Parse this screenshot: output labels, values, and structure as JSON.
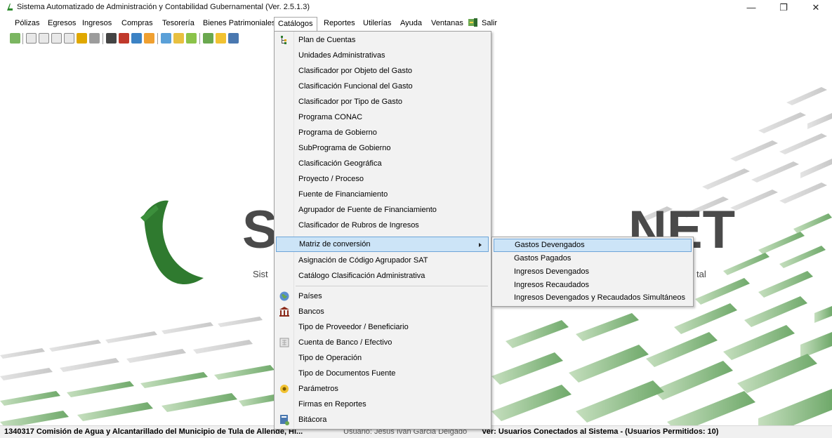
{
  "window": {
    "title": "Sistema Automatizado de Administración y Contabilidad Gubernamental  (Ver. 2.5.1.3)",
    "minimize": "—",
    "maximize": "❐",
    "close": "✕"
  },
  "menubar": {
    "items": [
      "Pólizas",
      "Egresos",
      "Ingresos",
      "Compras",
      "Tesorería",
      "Bienes Patrimoniales",
      "Catálogos",
      "Reportes",
      "Utilerías",
      "Ayuda",
      "Ventanas",
      "Salir"
    ]
  },
  "catalogos_menu": {
    "items": [
      "Plan de Cuentas",
      "Unidades Administrativas",
      "Clasificador por Objeto del Gasto",
      "Clasificación Funcional del Gasto",
      "Clasificador por Tipo de Gasto",
      "Programa CONAC",
      "Programa de Gobierno",
      "SubPrograma de Gobierno",
      "Clasificación Geográfica",
      "Proyecto / Proceso",
      "Fuente de Financiamiento",
      "Agrupador de Fuente de Financiamiento",
      "Clasificador de Rubros de Ingresos",
      "Matriz de conversión",
      "Asignación de Código Agrupador SAT",
      "Catálogo Clasificación Administrativa",
      "Países",
      "Bancos",
      "Tipo de Proveedor / Beneficiario",
      "Cuenta de Banco / Efectivo",
      "Tipo de Operación",
      "Tipo de Documentos Fuente",
      "Parámetros",
      "Firmas en Reportes",
      "Bitácora"
    ]
  },
  "matriz_submenu": {
    "items": [
      "Gastos Devengados",
      "Gastos Pagados",
      "Ingresos Devengados",
      "Ingresos Recaudados",
      "Ingresos Devengados y Recaudados Simultáneos"
    ]
  },
  "background": {
    "logo_left": "S",
    "logo_right": "NET",
    "tagline_left": "Sist",
    "tagline_right": "tal"
  },
  "statusbar": {
    "entity": "1340317 Comisión de Agua y Alcantarillado del Municipio de Tula de Allende, Hi...",
    "user": "Usuario: Jesus Ivan Garcia Delgado",
    "connected": "Ver: Usuarios Conectados al Sistema - (Usuarios Permitidos: 10)"
  },
  "colors": {
    "highlight": "#cce4f7",
    "highlight_border": "#6ea5d8",
    "logo_green": "#2e7d2e",
    "logo_gray": "#4a4a4a"
  }
}
